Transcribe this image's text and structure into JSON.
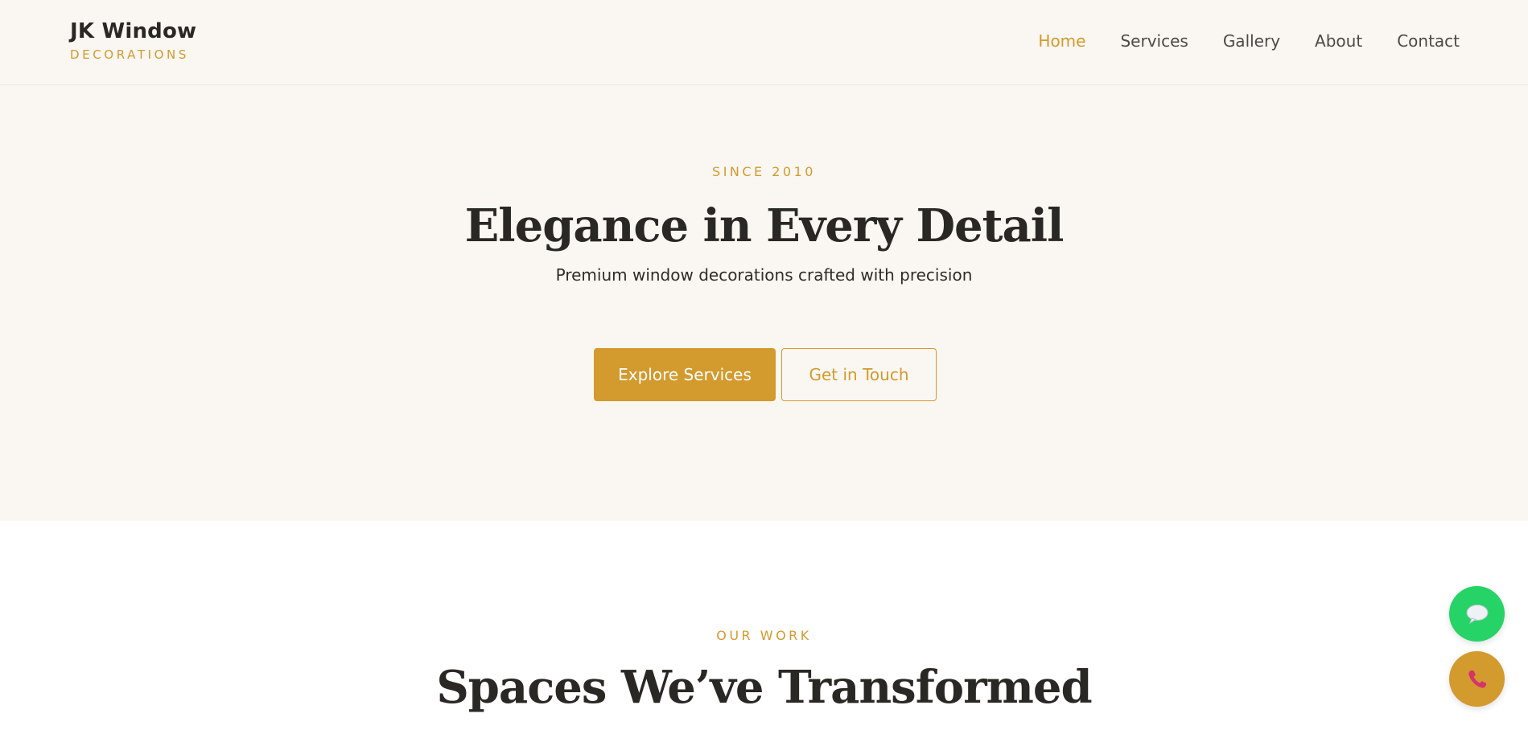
{
  "brand": {
    "name": "JK Window",
    "tagline": "DECORATIONS"
  },
  "nav": {
    "items": [
      {
        "label": "Home",
        "active": true
      },
      {
        "label": "Services",
        "active": false
      },
      {
        "label": "Gallery",
        "active": false
      },
      {
        "label": "About",
        "active": false
      },
      {
        "label": "Contact",
        "active": false
      }
    ]
  },
  "hero": {
    "eyebrow": "SINCE 2010",
    "title": "Elegance in Every Detail",
    "subtitle": "Premium window decorations crafted with precision",
    "primary_button": "Explore Services",
    "secondary_button": "Get in Touch"
  },
  "work": {
    "eyebrow": "OUR WORK",
    "title": "Spaces We’ve Transformed"
  },
  "fabs": {
    "chat_icon": "speech-bubble-icon",
    "phone_icon": "phone-icon"
  },
  "colors": {
    "accent": "#d39a2e",
    "background": "#faf7f2",
    "text": "#2a2824",
    "chat": "#26d366",
    "phone_glyph": "#d6336c"
  }
}
